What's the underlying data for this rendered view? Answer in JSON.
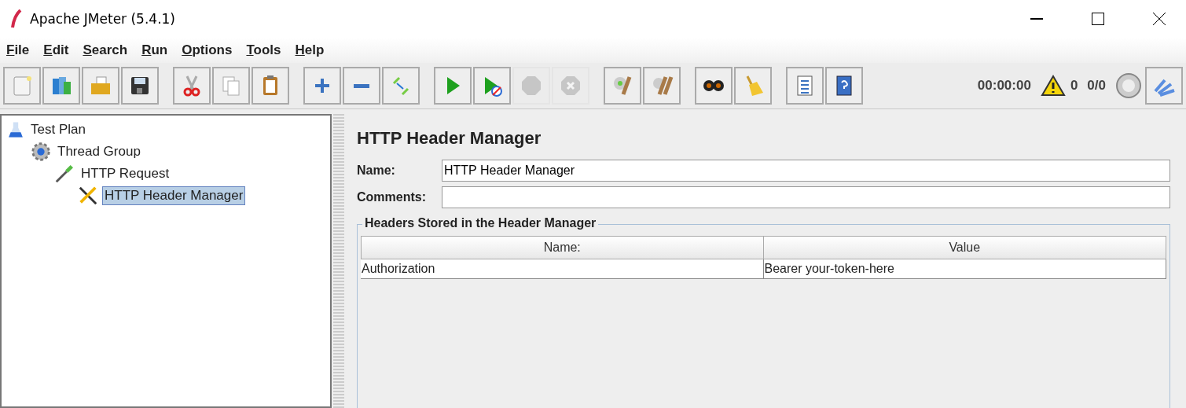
{
  "window": {
    "title": "Apache JMeter (5.4.1)"
  },
  "menu": [
    "File",
    "Edit",
    "Search",
    "Run",
    "Options",
    "Tools",
    "Help"
  ],
  "toolbar": [
    [
      {
        "kind": "new",
        "disabled": false
      },
      {
        "kind": "templates",
        "disabled": false
      },
      {
        "kind": "open",
        "disabled": false
      },
      {
        "kind": "save",
        "disabled": false
      }
    ],
    [
      {
        "kind": "cut",
        "disabled": false
      },
      {
        "kind": "copy",
        "disabled": false
      },
      {
        "kind": "paste",
        "disabled": false
      }
    ],
    [
      {
        "kind": "expand",
        "disabled": false
      },
      {
        "kind": "collapse",
        "disabled": false
      },
      {
        "kind": "toggle",
        "disabled": false
      }
    ],
    [
      {
        "kind": "start",
        "disabled": false
      },
      {
        "kind": "start-no-timers",
        "disabled": false
      },
      {
        "kind": "stop",
        "disabled": true
      },
      {
        "kind": "shutdown",
        "disabled": true
      }
    ],
    [
      {
        "kind": "clear",
        "disabled": false
      },
      {
        "kind": "clear-all",
        "disabled": false
      }
    ],
    [
      {
        "kind": "search",
        "disabled": false
      },
      {
        "kind": "reset",
        "disabled": false
      }
    ],
    [
      {
        "kind": "functions",
        "disabled": false
      },
      {
        "kind": "help",
        "disabled": false
      }
    ]
  ],
  "status": {
    "elapsed": "00:00:00",
    "errors": "0",
    "threads": "0/0"
  },
  "tree": [
    {
      "label": "Test Plan",
      "kind": "plan",
      "selected": false,
      "children": [
        {
          "label": "Thread Group",
          "kind": "threads",
          "selected": false,
          "children": [
            {
              "label": "HTTP Request",
              "kind": "sampler",
              "selected": false,
              "children": [
                {
                  "label": "HTTP Header Manager",
                  "kind": "config",
                  "selected": true
                }
              ]
            }
          ]
        }
      ]
    }
  ],
  "panel": {
    "title": "HTTP Header Manager",
    "name_label": "Name:",
    "name_value": "HTTP Header Manager",
    "comments_label": "Comments:",
    "group_title": "Headers Stored in the Header Manager",
    "columns": [
      "Name:",
      "Value"
    ],
    "rows": [
      [
        "Authorization",
        "Bearer your-token-here"
      ]
    ]
  }
}
